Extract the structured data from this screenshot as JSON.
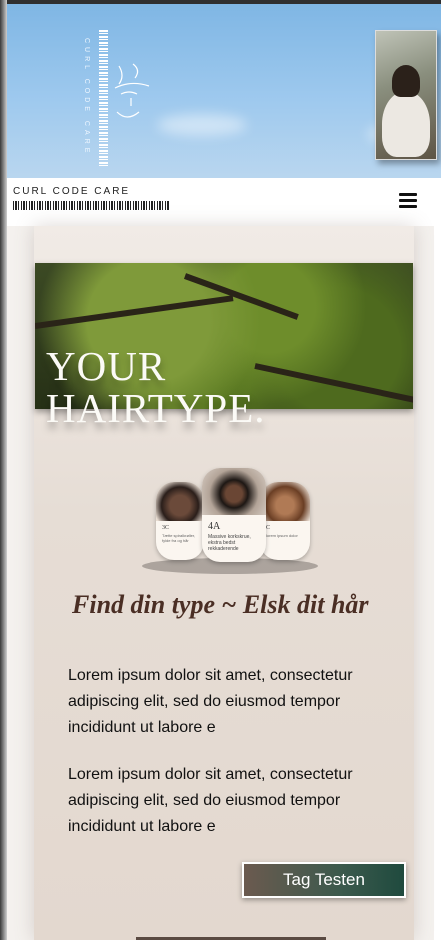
{
  "header": {
    "logo_vertical_text": "CURL CODE CARE",
    "brand": "CURL CODE CARE",
    "menu_icon": "hamburger-menu-icon"
  },
  "banner": {
    "title_line1": "YOUR",
    "title_line2": "HAIRTYPE."
  },
  "hair_types": {
    "left_label": "3C",
    "left_text": "Tætte spiralkrøller, fylde fra og hår",
    "center_label": "4A",
    "center_text": "Massive korkskrue, ekstra bedst rekkaderende",
    "right_label": "C",
    "right_text": "lorem ipsum dolor"
  },
  "main": {
    "tagline": "Find din type ~ Elsk dit hår",
    "paragraph1": "Lorem ipsum dolor sit amet, consectetur adipiscing elit, sed do eiusmod tempor incididunt ut labore e",
    "paragraph2": "Lorem ipsum dolor sit amet, consectetur adipiscing elit, sed do eiusmod tempor incididunt ut labore e",
    "cta_label": "Tag Testen"
  },
  "colors": {
    "sky": "#8fc0ea",
    "card_bg": "#e6ddd5",
    "tagline": "#4a2e24",
    "cta_start": "#6b5a4f",
    "cta_end": "#1f4a3e"
  }
}
